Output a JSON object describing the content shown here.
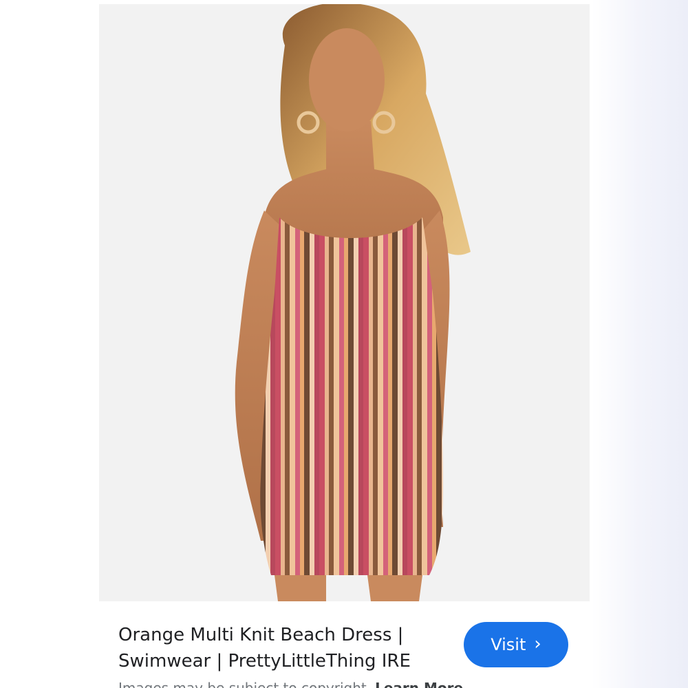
{
  "result": {
    "title": "Orange Multi Knit Beach Dress | Swimwear | PrettyLittleThing IRE",
    "visit_label": "Visit",
    "visit_chevron_icon": "chevron-right-icon",
    "copyright_notice": "Images may be subject to copyright.",
    "learn_more_label": "Learn More"
  },
  "colors": {
    "visit_button": "#1a73e8",
    "title_text": "#202124",
    "notice_text": "#70757a",
    "photo_background": "#f2f2f2"
  }
}
